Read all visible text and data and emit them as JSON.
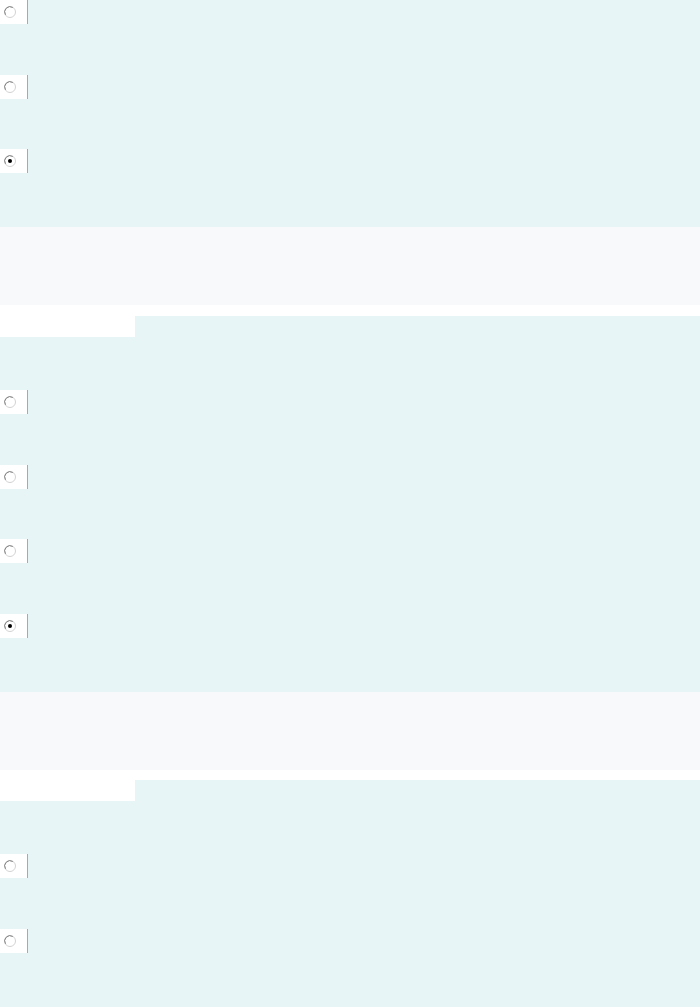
{
  "questions": [
    {
      "options": [
        {
          "selected": false
        },
        {
          "selected": false
        },
        {
          "selected": true
        }
      ]
    },
    {
      "options": [
        {
          "selected": false
        },
        {
          "selected": false
        },
        {
          "selected": false
        },
        {
          "selected": true
        }
      ]
    },
    {
      "options": [
        {
          "selected": false
        },
        {
          "selected": false
        }
      ]
    }
  ]
}
